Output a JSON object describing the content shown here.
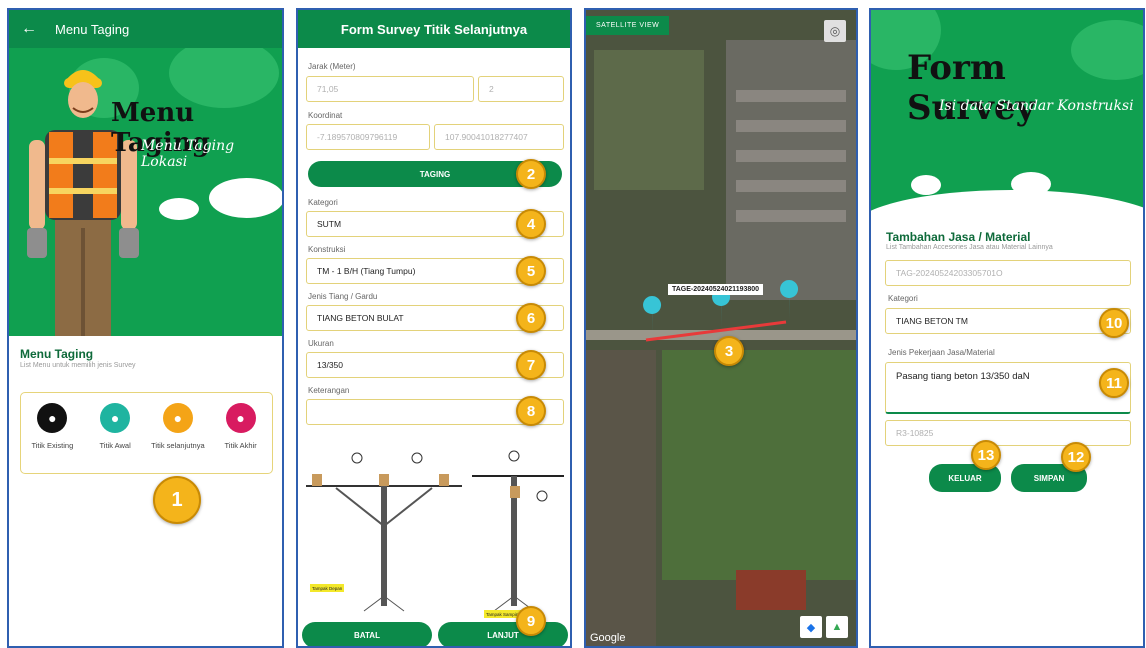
{
  "screen1": {
    "appbar_title": "Menu Taging",
    "banner_title": "Menu Taging",
    "banner_subtitle": "Menu Taging Lokasi",
    "section_title": "Menu Taging",
    "section_subtitle": "List Menu untuk memilih jenis Survey",
    "items": [
      {
        "label": "Titik Existing",
        "color": "#111111",
        "icon": "location-pin-icon"
      },
      {
        "label": "Titik Awal",
        "color": "#1fb4a0",
        "icon": "location-pin-icon"
      },
      {
        "label": "Titik selanjutnya",
        "color": "#f4a417",
        "icon": "location-pin-icon"
      },
      {
        "label": "Titik Akhir",
        "color": "#d81b60",
        "icon": "location-pin-icon"
      }
    ],
    "badge": "1"
  },
  "screen2": {
    "header": "Form Survey Titik Selanjutnya",
    "jarak_label": "Jarak (Meter)",
    "jarak_value": "71,05",
    "jarak_extra": "2",
    "koordinat_label": "Koordinat",
    "lat": "-7.189570809796119",
    "lng": "107.90041018277407",
    "taging_button": "TAGING",
    "kategori_label": "Kategori",
    "kategori_value": "SUTM",
    "konstruksi_label": "Konstruksi",
    "konstruksi_value": "TM - 1 B/H (Tiang Tumpu)",
    "jenis_label": "Jenis Tiang / Gardu",
    "jenis_value": "TIANG BETON BULAT",
    "ukuran_label": "Ukuran",
    "ukuran_value": "13/350",
    "keterangan_label": "Keterangan",
    "keterangan_value": "",
    "batal_button": "BATAL",
    "lanjut_button": "LANJUT",
    "diagram_tag1": "Tampak Depan",
    "diagram_tag2": "Tampak Samping",
    "badges": {
      "b2": "2",
      "b4": "4",
      "b5": "5",
      "b6": "6",
      "b7": "7",
      "b8": "8",
      "b9": "9"
    }
  },
  "screen3": {
    "satellite_tag": "SATELLITE VIEW",
    "pin_label": "TAGE-20240524021193800",
    "google": "Google",
    "badge": "3"
  },
  "screen4": {
    "title": "Form Survey",
    "subtitle": "Isi data Standar Konstruksi",
    "section_title": "Tambahan Jasa / Material",
    "section_subtitle": "List Tambahan Accesories Jasa atau Material Lainnya",
    "tag_value": "TAG-20240524203305701O",
    "kategori_label": "Kategori",
    "kategori_value": "TIANG BETON TM",
    "jenis_label": "Jenis Pekerjaan Jasa/Material",
    "jenis_value": "Pasang tiang beton 13/350 daN",
    "code_value": "R3-10825",
    "keluar_button": "KELUAR",
    "simpan_button": "SIMPAN",
    "badges": {
      "b10": "10",
      "b11": "11",
      "b12": "12",
      "b13": "13"
    }
  }
}
